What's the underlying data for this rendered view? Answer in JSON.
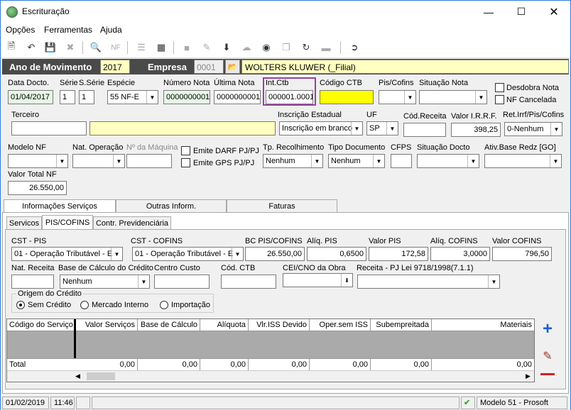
{
  "window": {
    "title": "Escrituração"
  },
  "menu": [
    "Opções",
    "Ferramentas",
    "Ajuda"
  ],
  "header": {
    "ano_label": "Ano de Movimento",
    "ano_value": "2017",
    "empresa_label": "Empresa",
    "empresa_code": "0001",
    "empresa_name": "WOLTERS KLUWER (_Filial)"
  },
  "row1": {
    "data_docto": {
      "label": "Data Docto.",
      "value": "01/04/2017"
    },
    "serie": {
      "label": "Série",
      "value": "1"
    },
    "sserie": {
      "label": "S.Série",
      "value": "1"
    },
    "especie": {
      "label": "Espécie",
      "value": "55 NF-E"
    },
    "numero_nota": {
      "label": "Número Nota",
      "value": "0000000001"
    },
    "ultima_nota": {
      "label": "Última Nota",
      "value": "0000000001"
    },
    "int_ctb": {
      "label": "Int.Ctb",
      "value": "000001.0001"
    },
    "codigo_ctb": {
      "label": "Código CTB",
      "value": ""
    },
    "pis_cofins": {
      "label": "Pis/Cofins",
      "value": ""
    },
    "situacao_nota": {
      "label": "Situação Nota",
      "value": ""
    },
    "desdobra_nota": "Desdobra Nota",
    "nf_cancelada": "NF Cancelada"
  },
  "row2": {
    "terceiro": {
      "label": "Terceiro"
    },
    "inscricao": {
      "label": "Inscrição Estadual",
      "value": "Inscrição em branco"
    },
    "uf": {
      "label": "UF",
      "value": "SP"
    },
    "cod_receita": {
      "label": "Cód.Receita"
    },
    "valor_irrf": {
      "label": "Valor I.R.R.F.",
      "value": "398,25"
    },
    "ret_irrf": {
      "label": "Ret.Irrf/Pis/Cofins",
      "value": "0-Nenhum"
    }
  },
  "row3": {
    "modelo_nf": {
      "label": "Modelo NF"
    },
    "nat_operacao": {
      "label": "Nat. Operação"
    },
    "num_maquina": {
      "label": "Nº da Máquina"
    },
    "emite_darf": "Emite DARF PJ/PJ",
    "emite_gps": "Emite GPS PJ/PJ",
    "tp_recolhimento": {
      "label": "Tp. Recolhimento",
      "value": "Nenhum"
    },
    "tipo_documento": {
      "label": "Tipo Documento",
      "value": "Nenhum"
    },
    "cfps": {
      "label": "CFPS"
    },
    "situacao_docto": {
      "label": "Situação Docto"
    },
    "ativ_base": {
      "label": "Ativ.Base Redz [GO]"
    }
  },
  "valor_total": {
    "label": "Valor Total NF",
    "value": "26.550,00"
  },
  "main_tabs": [
    "Informações Serviços",
    "Outras Inform.",
    "Faturas"
  ],
  "sub_tabs": [
    "Servicos",
    "PIS/COFINS",
    "Contr. Previdenciária"
  ],
  "pis": {
    "cst_pis": {
      "label": "CST - PIS",
      "value": "01 - Operação Tributável - E"
    },
    "cst_cofins": {
      "label": "CST - COFINS",
      "value": "01 - Operação Tributável - E"
    },
    "bc": {
      "label": "BC PIS/COFINS",
      "value": "26.550,00"
    },
    "aliq_pis": {
      "label": "Alíq. PIS",
      "value": "0,6500"
    },
    "valor_pis": {
      "label": "Valor PIS",
      "value": "172,58"
    },
    "aliq_cofins": {
      "label": "Alíq. COFINS",
      "value": "3,0000"
    },
    "valor_cofins": {
      "label": "Valor COFINS",
      "value": "796,50"
    },
    "nat_receita": {
      "label": "Nat. Receita"
    },
    "base_credito": {
      "label": "Base de Cálculo do Crédito",
      "value": "Nenhum"
    },
    "centro_custo": {
      "label": "Centro Custo"
    },
    "cod_ctb": {
      "label": "Cód. CTB"
    },
    "cei": {
      "label": "CEI/CNO da Obra"
    },
    "receita_lei": {
      "label": "Receita - PJ Lei 9718/1998(7.1.1)"
    },
    "origem": {
      "label": "Origem do Crédito",
      "options": [
        "Sem Crédito",
        "Mercado Interno",
        "Importação"
      ]
    }
  },
  "grid": {
    "columns": [
      "Código do Serviço",
      "Valor Serviços",
      "Base de Cálculo",
      "Alíquota",
      "Vlr.ISS Devido",
      "Oper.sem ISS",
      "Subempreitada",
      "Materiais"
    ],
    "total_label": "Total",
    "totals": [
      "0,00",
      "0,00",
      "0,00",
      "0,00",
      "0,00",
      "0,00",
      "0,00"
    ]
  },
  "status": {
    "date": "01/02/2019",
    "time": "11:46",
    "model": "Modelo 51 - Prosoft"
  },
  "colors": {
    "header_bg": "#4a4a4a",
    "int_ctb_border": "#9b3fa3",
    "codigo_ctb_bg": "#ffff00",
    "empresa_name_bg": "#ffffc0",
    "plus_color": "#1a5fd6",
    "minus_color": "#d62020"
  }
}
